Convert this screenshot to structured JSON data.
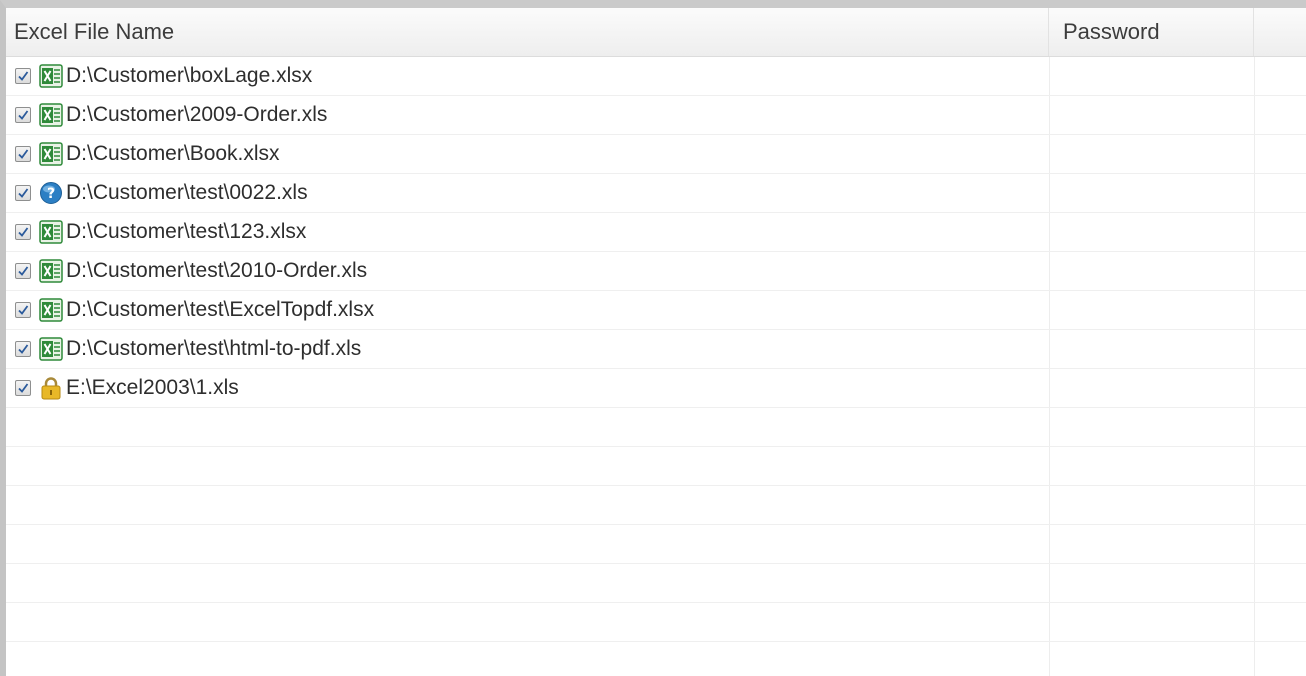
{
  "columns": {
    "file_name": "Excel File Name",
    "password": "Password"
  },
  "files": [
    {
      "path": "D:\\Customer\\boxLage.xlsx",
      "checked": true,
      "icon": "excel-file-icon",
      "password": ""
    },
    {
      "path": "D:\\Customer\\2009-Order.xls",
      "checked": true,
      "icon": "excel-file-icon",
      "password": ""
    },
    {
      "path": "D:\\Customer\\Book.xlsx",
      "checked": true,
      "icon": "excel-file-icon",
      "password": ""
    },
    {
      "path": "D:\\Customer\\test\\0022.xls",
      "checked": true,
      "icon": "unknown-file-icon",
      "password": ""
    },
    {
      "path": "D:\\Customer\\test\\123.xlsx",
      "checked": true,
      "icon": "excel-file-icon",
      "password": ""
    },
    {
      "path": "D:\\Customer\\test\\2010-Order.xls",
      "checked": true,
      "icon": "excel-file-icon",
      "password": ""
    },
    {
      "path": "D:\\Customer\\test\\ExcelTopdf.xlsx",
      "checked": true,
      "icon": "excel-file-icon",
      "password": ""
    },
    {
      "path": "D:\\Customer\\test\\html-to-pdf.xls",
      "checked": true,
      "icon": "excel-file-icon",
      "password": ""
    },
    {
      "path": "E:\\Excel2003\\1.xls",
      "checked": true,
      "icon": "lock-icon",
      "password": ""
    }
  ],
  "colors": {
    "excel_green": "#2f8a3a",
    "question_blue": "#2c7fc4",
    "lock_gold": "#e8b828"
  }
}
